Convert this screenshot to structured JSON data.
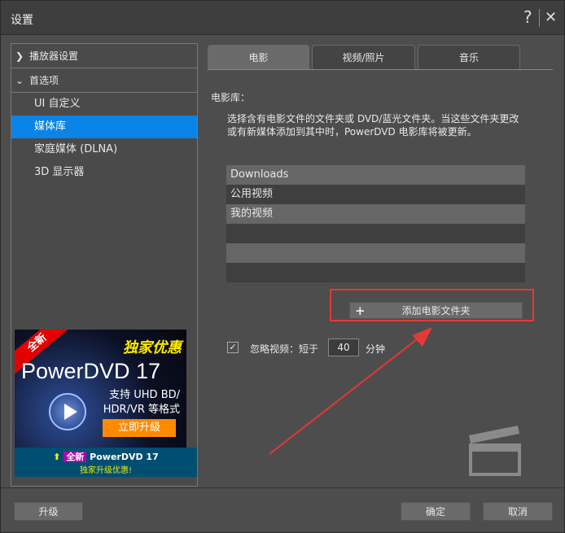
{
  "window": {
    "title": "设置",
    "help": "?",
    "close": "✕"
  },
  "sidebar": {
    "groups": [
      {
        "label": "播放器设置",
        "expanded": false
      },
      {
        "label": "首选项",
        "expanded": true
      }
    ],
    "items": [
      {
        "label": "UI 自定义"
      },
      {
        "label": "媒体库",
        "selected": true
      },
      {
        "label": "家庭媒体 (DLNA)"
      },
      {
        "label": "3D 显示器"
      }
    ]
  },
  "ad": {
    "badge": "全新",
    "slogan": "独家优惠",
    "product": "PowerDVD 17",
    "feature1": "支持 UHD BD/",
    "feature2": "HDR/VR 等格式",
    "cta": "立即升級",
    "bar_new": "全新",
    "bar_product": "PowerDVD 17",
    "bar_sub": "独家升级优惠!"
  },
  "tabs": [
    {
      "label": "电影",
      "active": true
    },
    {
      "label": "视频/照片"
    },
    {
      "label": "音乐"
    }
  ],
  "main": {
    "section_label": "电影库：",
    "description": "选择含有电影文件的文件夹或 DVD/蓝光文件夹。当这些文件夹更改或有新媒体添加到其中时，PowerDVD 电影库将被更新。",
    "folders": [
      "Downloads",
      "公用视频",
      "我的视频",
      "",
      ""
    ],
    "add_button": "添加电影文件夹",
    "ignore_label": "忽略视频：短于",
    "ignore_checked": true,
    "ignore_value": "40",
    "ignore_unit": "分钟"
  },
  "footer": {
    "upgrade": "升级",
    "ok": "确定",
    "cancel": "取消"
  },
  "colors": {
    "selection": "#0a84e6",
    "highlight": "#e53935"
  }
}
